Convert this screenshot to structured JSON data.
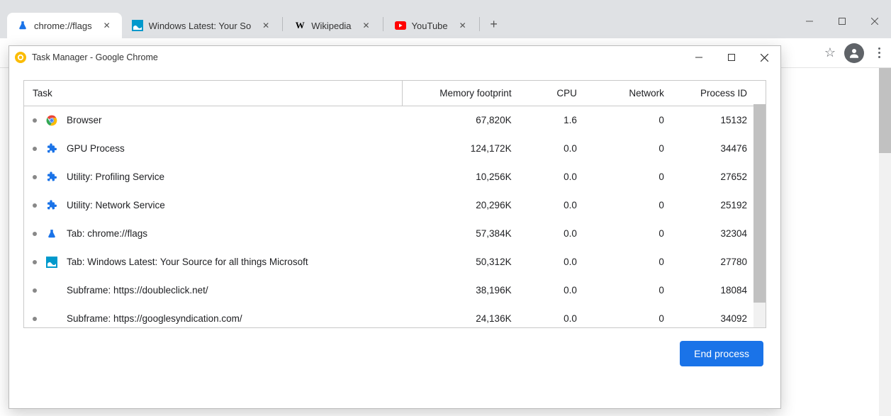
{
  "browser": {
    "tabs": [
      {
        "label": "chrome://flags",
        "icon": "flask",
        "active": true
      },
      {
        "label": "Windows Latest: Your So",
        "icon": "wl",
        "active": false
      },
      {
        "label": "Wikipedia",
        "icon": "wiki",
        "active": false
      },
      {
        "label": "YouTube",
        "icon": "yt",
        "active": false
      }
    ]
  },
  "task_manager": {
    "title": "Task Manager - Google Chrome",
    "columns": {
      "task": "Task",
      "memory": "Memory footprint",
      "cpu": "CPU",
      "network": "Network",
      "pid": "Process ID"
    },
    "rows": [
      {
        "icon": "chrome",
        "name": "Browser",
        "memory": "67,820K",
        "cpu": "1.6",
        "network": "0",
        "pid": "15132"
      },
      {
        "icon": "ext",
        "name": "GPU Process",
        "memory": "124,172K",
        "cpu": "0.0",
        "network": "0",
        "pid": "34476"
      },
      {
        "icon": "ext",
        "name": "Utility: Profiling Service",
        "memory": "10,256K",
        "cpu": "0.0",
        "network": "0",
        "pid": "27652"
      },
      {
        "icon": "ext",
        "name": "Utility: Network Service",
        "memory": "20,296K",
        "cpu": "0.0",
        "network": "0",
        "pid": "25192"
      },
      {
        "icon": "flask",
        "name": "Tab: chrome://flags",
        "memory": "57,384K",
        "cpu": "0.0",
        "network": "0",
        "pid": "32304"
      },
      {
        "icon": "wl",
        "name": "Tab: Windows Latest: Your Source for all things Microsoft",
        "memory": "50,312K",
        "cpu": "0.0",
        "network": "0",
        "pid": "27780"
      },
      {
        "icon": "none",
        "name": "Subframe: https://doubleclick.net/",
        "memory": "38,196K",
        "cpu": "0.0",
        "network": "0",
        "pid": "18084"
      },
      {
        "icon": "none",
        "name": "Subframe: https://googlesyndication.com/",
        "memory": "24,136K",
        "cpu": "0.0",
        "network": "0",
        "pid": "34092"
      }
    ],
    "end_button": "End process"
  }
}
